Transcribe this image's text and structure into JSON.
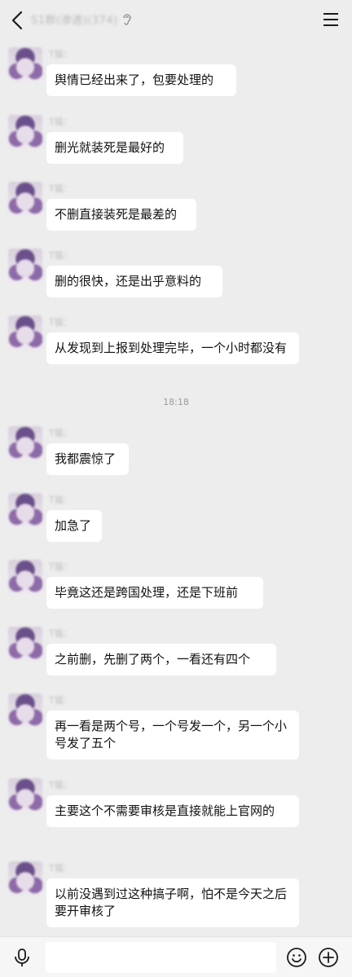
{
  "header": {
    "title": "S1群(渗透)(374)"
  },
  "messages": [
    {
      "sender": "T猫：",
      "text": "舆情已经出来了，包要处理的"
    },
    {
      "sender": "T猫：",
      "text": "删光就装死是最好的"
    },
    {
      "sender": "T猫：",
      "text": "不删直接装死是最差的"
    },
    {
      "sender": "T猫：",
      "text": "删的很快，还是出乎意料的"
    },
    {
      "sender": "T猫：",
      "text": "从发现到上报到处理完毕，一个小时都没有"
    },
    {
      "sender": "T猫：",
      "text": "我都震惊了"
    },
    {
      "sender": "T猫：",
      "text": "加急了"
    },
    {
      "sender": "T猫：",
      "text": "毕竟这还是跨国处理，还是下班前"
    },
    {
      "sender": "T猫：",
      "text": "之前删，先删了两个，一看还有四个"
    },
    {
      "sender": "T猫：",
      "text": "再一看是两个号，一个号发一个，另一个小号发了五个"
    },
    {
      "sender": "T猫：",
      "text": "主要这个不需要审核是直接就能上官网的"
    },
    {
      "sender": "T猫：",
      "text": "以前没遇到过这种搞子啊，怕不是今天之后要开审核了"
    }
  ],
  "timestamp": "18:18",
  "icons": {
    "back": "back-arrow-icon",
    "ear": "ear-icon",
    "menu": "menu-icon",
    "voice": "voice-icon",
    "emoji": "emoji-icon",
    "plus": "plus-icon"
  },
  "colors": {
    "background": "#ededed",
    "bubble": "#ffffff"
  }
}
